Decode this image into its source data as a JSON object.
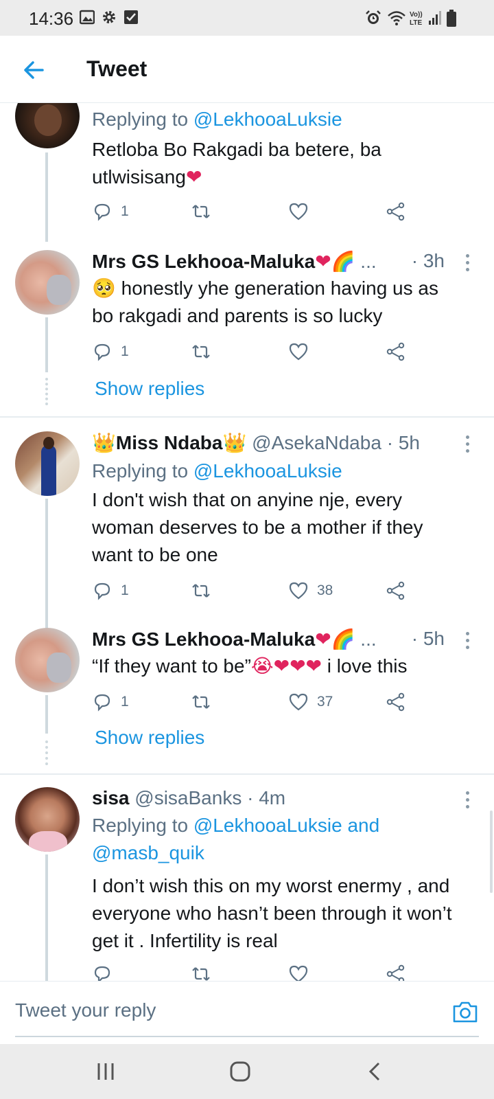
{
  "status_bar": {
    "time": "14:36",
    "left_icons": [
      "image-icon",
      "gear-icon",
      "check-box-icon"
    ],
    "right_icons": [
      "alarm-icon",
      "wifi-icon",
      "volte-icon",
      "signal-icon",
      "battery-icon"
    ],
    "volte_label": "Vo)) LTE"
  },
  "header": {
    "title": "Tweet",
    "back_icon": "arrow-left-icon"
  },
  "tweets": [
    {
      "replying_prefix": "Replying to ",
      "replying_to": "@LekhooaLuksie",
      "text_1": "Retloba Bo Rakgadi ba betere, ba",
      "text_2": "utlwisisang",
      "text_2_emoji": "❤",
      "reply_count": "1",
      "like_count": ""
    },
    {
      "name": "Mrs GS Lekhooa-Maluka",
      "name_emoji": "❤🌈",
      "ellipsis": "...",
      "time": "· 3h",
      "emoji_lead": "🥺",
      "text_1": " honestly yhe generation having us as",
      "text_2": "bo rakgadi and parents is so lucky",
      "reply_count": "1",
      "like_count": "",
      "show_replies": "Show replies"
    },
    {
      "name_prefix_emoji": "👑",
      "name": "Miss Ndaba",
      "name_suffix_emoji": "👑",
      "handle": "@AsekaNdaba",
      "time": "· 5h",
      "replying_prefix": "Replying to ",
      "replying_to": "@LekhooaLuksie",
      "text_1": "I don't wish that on anyine nje, every",
      "text_2": "woman deserves to be a mother if they",
      "text_3": "want to be one",
      "reply_count": "1",
      "like_count": "38"
    },
    {
      "name": "Mrs GS Lekhooa-Maluka",
      "name_emoji": "❤🌈",
      "ellipsis": "...",
      "time": "· 5h",
      "text_quote": "“If they want to be”",
      "text_emoji": "😭❤❤❤",
      "text_tail": " i love this",
      "reply_count": "1",
      "like_count": "37",
      "show_replies": "Show replies"
    },
    {
      "name": "sisa",
      "handle": "@sisaBanks",
      "time": "· 4m",
      "replying_prefix": "Replying to ",
      "replying_to": "@LekhooaLuksie and",
      "replying_to_2": "@masb_quik",
      "text_1": "I don’t wish this on my worst enermy , and",
      "text_2": "everyone who hasn’t been through it won’t",
      "text_3": "get it . Infertility is real"
    }
  ],
  "reply_bar": {
    "placeholder": "Tweet your reply",
    "camera_icon": "camera-icon"
  },
  "nav_bar": {
    "icons": [
      "recent-apps-icon",
      "home-icon",
      "back-icon"
    ]
  },
  "colors": {
    "accent": "#1b95e0",
    "text": "#14171a",
    "muted": "#5b7083",
    "heart": "#e0245e"
  }
}
